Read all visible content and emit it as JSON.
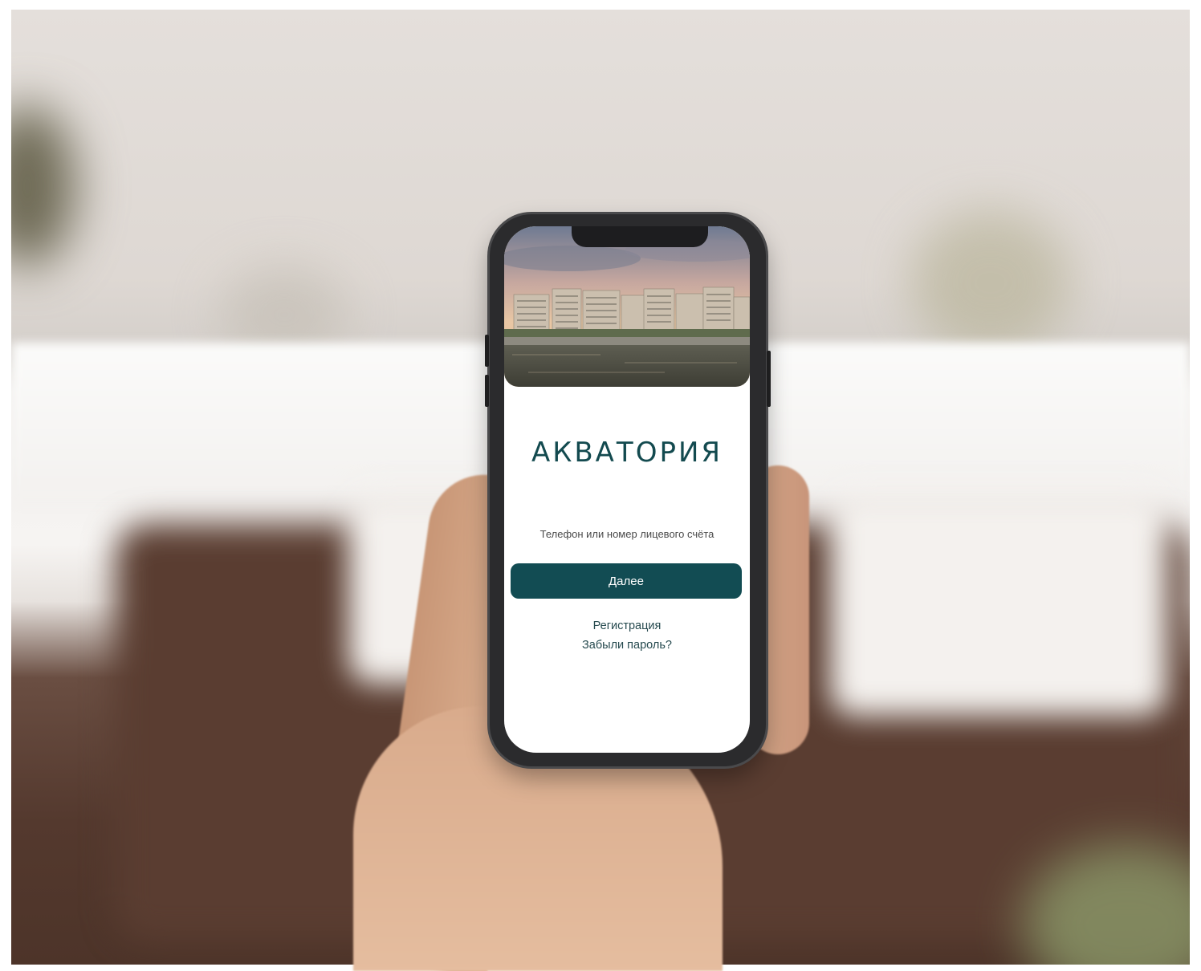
{
  "app": {
    "logo_text": "АКВАТОРИЯ"
  },
  "login": {
    "phone_placeholder": "Телефон или номер лицевого счёта",
    "next_label": "Далее",
    "register_label": "Регистрация",
    "forgot_label": "Забыли пароль?"
  },
  "colors": {
    "brand": "#124c53",
    "logo": "#134a4f",
    "screen_bg": "#ffffff"
  },
  "icons": {
    "hero": "building-photo"
  }
}
